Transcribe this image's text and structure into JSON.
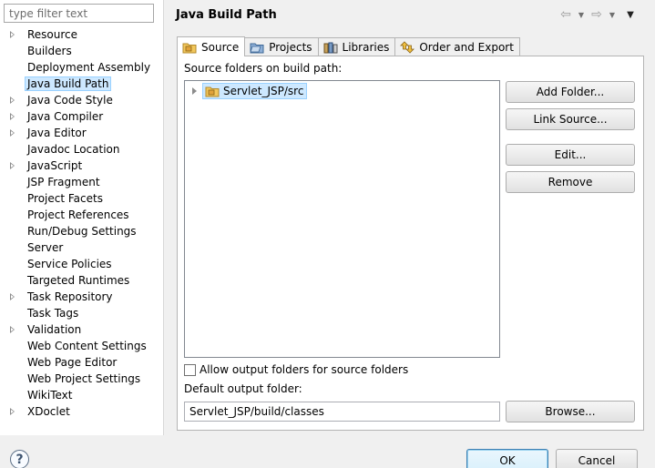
{
  "filter": {
    "placeholder": "type filter text"
  },
  "tree": [
    {
      "label": "Resource",
      "expandable": true,
      "selected": false
    },
    {
      "label": "Builders",
      "expandable": false,
      "selected": false
    },
    {
      "label": "Deployment Assembly",
      "expandable": false,
      "selected": false
    },
    {
      "label": "Java Build Path",
      "expandable": false,
      "selected": true
    },
    {
      "label": "Java Code Style",
      "expandable": true,
      "selected": false
    },
    {
      "label": "Java Compiler",
      "expandable": true,
      "selected": false
    },
    {
      "label": "Java Editor",
      "expandable": true,
      "selected": false
    },
    {
      "label": "Javadoc Location",
      "expandable": false,
      "selected": false
    },
    {
      "label": "JavaScript",
      "expandable": true,
      "selected": false
    },
    {
      "label": "JSP Fragment",
      "expandable": false,
      "selected": false
    },
    {
      "label": "Project Facets",
      "expandable": false,
      "selected": false
    },
    {
      "label": "Project References",
      "expandable": false,
      "selected": false
    },
    {
      "label": "Run/Debug Settings",
      "expandable": false,
      "selected": false
    },
    {
      "label": "Server",
      "expandable": false,
      "selected": false
    },
    {
      "label": "Service Policies",
      "expandable": false,
      "selected": false
    },
    {
      "label": "Targeted Runtimes",
      "expandable": false,
      "selected": false
    },
    {
      "label": "Task Repository",
      "expandable": true,
      "selected": false
    },
    {
      "label": "Task Tags",
      "expandable": false,
      "selected": false
    },
    {
      "label": "Validation",
      "expandable": true,
      "selected": false
    },
    {
      "label": "Web Content Settings",
      "expandable": false,
      "selected": false
    },
    {
      "label": "Web Page Editor",
      "expandable": false,
      "selected": false
    },
    {
      "label": "Web Project Settings",
      "expandable": false,
      "selected": false
    },
    {
      "label": "WikiText",
      "expandable": false,
      "selected": false
    },
    {
      "label": "XDoclet",
      "expandable": true,
      "selected": false
    }
  ],
  "header": {
    "title": "Java Build Path"
  },
  "tabs": [
    {
      "label": "Source",
      "icon": "source-folder-icon",
      "active": true
    },
    {
      "label": "Projects",
      "icon": "projects-icon",
      "active": false
    },
    {
      "label": "Libraries",
      "icon": "libraries-icon",
      "active": false
    },
    {
      "label": "Order and Export",
      "icon": "order-export-icon",
      "active": false
    }
  ],
  "source": {
    "list_label": "Source folders on build path:",
    "folders": [
      "Servlet_JSP/src"
    ],
    "buttons": {
      "add_folder": "Add Folder...",
      "link_source": "Link Source...",
      "edit": "Edit...",
      "remove": "Remove"
    },
    "allow_output_label": "Allow output folders for source folders",
    "allow_output_checked": false,
    "default_output_label": "Default output folder:",
    "default_output_value": "Servlet_JSP/build/classes",
    "browse": "Browse..."
  },
  "footer": {
    "ok": "OK",
    "cancel": "Cancel",
    "help": "?"
  },
  "colors": {
    "selection": "#cde8ff",
    "selection_border": "#99d1ff",
    "folder": "#e8b64a"
  }
}
